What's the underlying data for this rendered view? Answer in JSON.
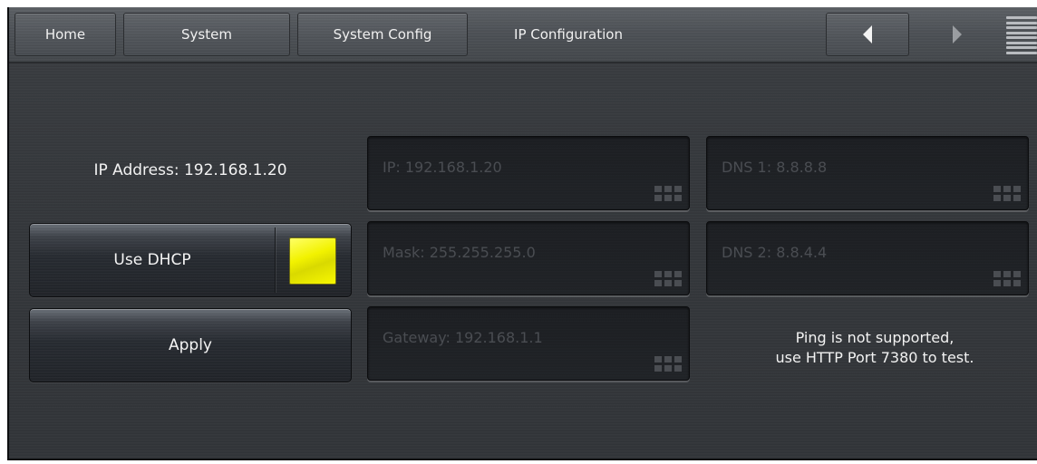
{
  "nav": {
    "tabs": [
      {
        "label": "Home"
      },
      {
        "label": "System"
      },
      {
        "label": "System Config"
      }
    ],
    "current_page": "IP Configuration",
    "back_icon": "triangle-left-icon",
    "forward_icon": "triangle-right-icon",
    "menu_icon": "hamburger-menu-icon"
  },
  "network": {
    "ip_address_label": "IP Address: 192.168.1.20",
    "dhcp_label": "Use DHCP",
    "dhcp_enabled": true,
    "apply_label": "Apply",
    "fields": {
      "ip": "IP: 192.168.1.20",
      "mask": "Mask: 255.255.255.0",
      "gateway": "Gateway: 192.168.1.1",
      "dns1": "DNS 1: 8.8.8.8",
      "dns2": "DNS 2: 8.8.4.4"
    },
    "ping_note_line1": "Ping is not supported,",
    "ping_note_line2": "use HTTP Port 7380 to test."
  },
  "colors": {
    "background": "#35383c",
    "checkbox_on": "#f2f200",
    "field_text": "#4a4d52"
  }
}
